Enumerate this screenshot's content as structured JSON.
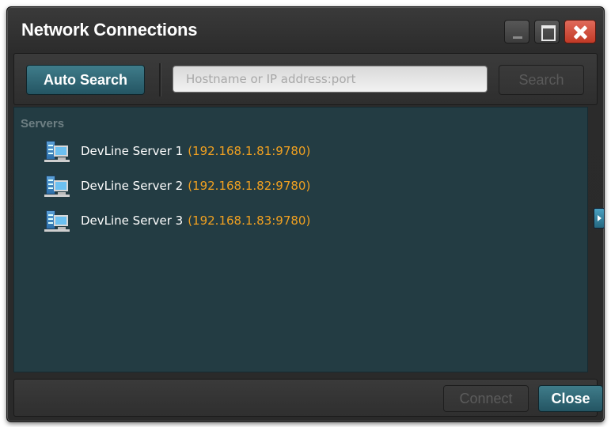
{
  "window": {
    "title": "Network Connections"
  },
  "toolbar": {
    "auto_search_label": "Auto Search",
    "search_placeholder": "Hostname or IP address:port",
    "search_value": "",
    "search_label": "Search"
  },
  "servers": {
    "group_label": "Servers",
    "items": [
      {
        "name": "DevLine Server 1",
        "address": "(192.168.1.81:9780)"
      },
      {
        "name": "DevLine Server 2",
        "address": "(192.168.1.82:9780)"
      },
      {
        "name": "DevLine Server 3",
        "address": "(192.168.1.83:9780)"
      }
    ]
  },
  "footer": {
    "connect_label": "Connect",
    "close_label": "Close"
  },
  "colors": {
    "accent": "#2f6a78",
    "address_text": "#f0a020",
    "list_background": "#233c43",
    "close_button": "#c23a26"
  },
  "icons": [
    "minimize-icon",
    "maximize-icon",
    "close-icon",
    "server-icon",
    "expand-arrow-icon"
  ]
}
